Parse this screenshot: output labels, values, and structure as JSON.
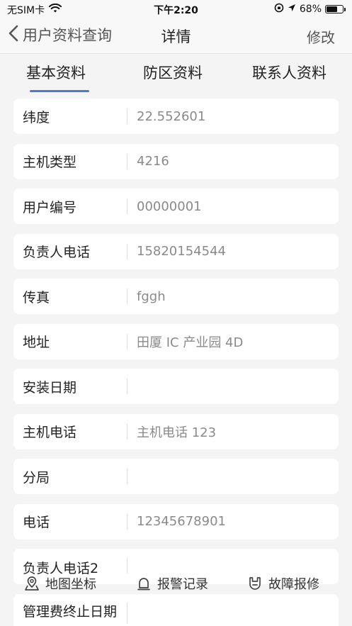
{
  "status_bar": {
    "carrier": "无SIM卡",
    "time": "下午2:20",
    "battery": "68%",
    "battery_level": 0.68
  },
  "nav": {
    "back_label": "用户资料查询",
    "title": "详情",
    "action_label": "修改"
  },
  "tabs": [
    {
      "label": "基本资料"
    },
    {
      "label": "防区资料"
    },
    {
      "label": "联系人资料"
    }
  ],
  "fields": [
    {
      "label": "纬度",
      "value": "22.552601"
    },
    {
      "label": "主机类型",
      "value": "4216"
    },
    {
      "label": "用户编号",
      "value": "00000001"
    },
    {
      "label": "负责人电话",
      "value": "15820154544"
    },
    {
      "label": "传真",
      "value": "fggh"
    },
    {
      "label": "地址",
      "value": "田厦 IC 产业园 4D"
    },
    {
      "label": "安装日期",
      "value": ""
    },
    {
      "label": "主机电话",
      "value": "主机电话 123"
    },
    {
      "label": "分局",
      "value": ""
    },
    {
      "label": "电话",
      "value": "12345678901"
    },
    {
      "label": "负责人电话2",
      "value": ""
    },
    {
      "label": "管理费终止日期",
      "value": ""
    }
  ],
  "toolbar": [
    {
      "label": "地图坐标",
      "icon": "map-pin-icon"
    },
    {
      "label": "报警记录",
      "icon": "bell-icon"
    },
    {
      "label": "故障报修",
      "icon": "repair-icon"
    }
  ]
}
